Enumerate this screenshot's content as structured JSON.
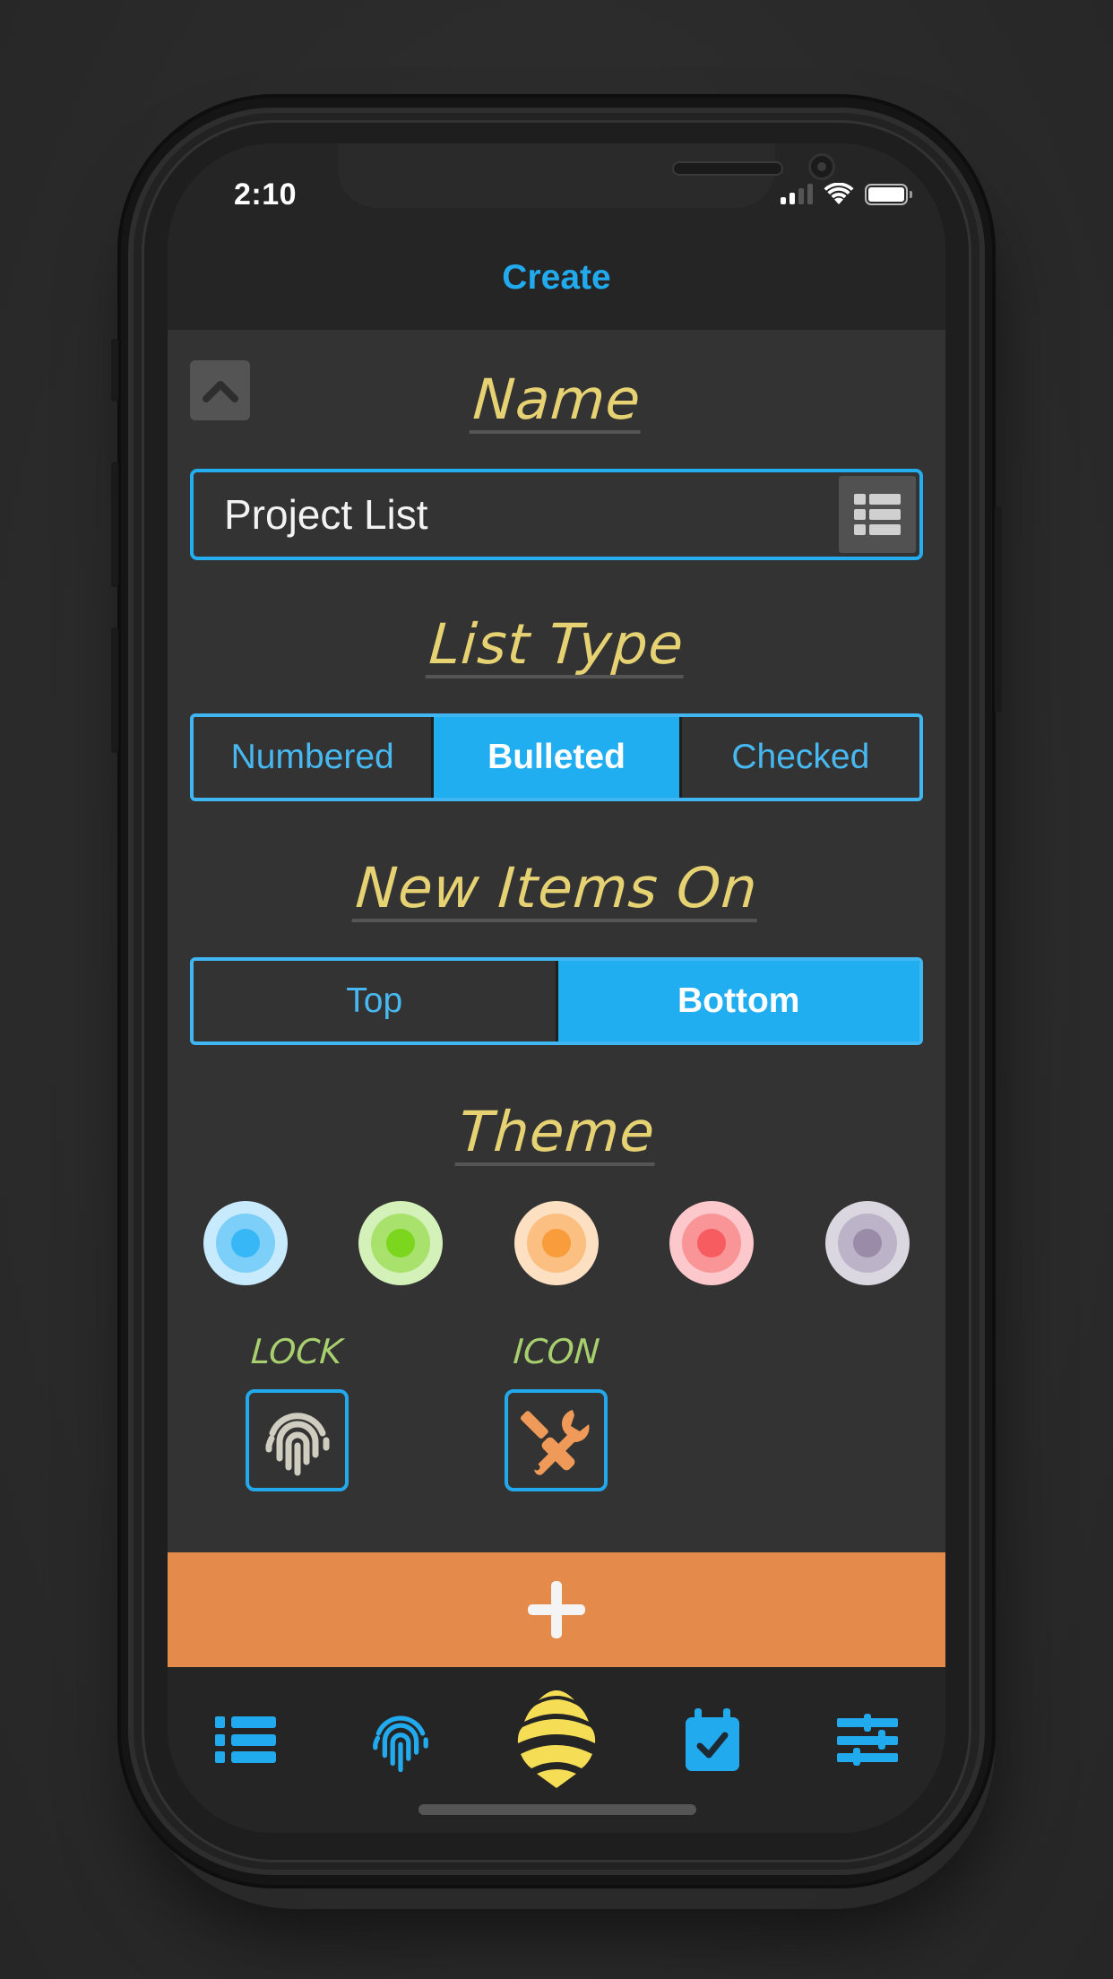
{
  "status_bar": {
    "time": "2:10",
    "signal_bars_filled": 2,
    "signal_bars_total": 4,
    "wifi_icon": "wifi-icon",
    "battery_icon": "battery-full-icon"
  },
  "header": {
    "title": "Create"
  },
  "collapse_button": {
    "icon": "chevron-up-icon"
  },
  "name_section": {
    "title": "Name",
    "input_value": "Project List",
    "list_picker_icon": "list-grid-icon"
  },
  "list_type_section": {
    "title": "List Type",
    "options": [
      "Numbered",
      "Bulleted",
      "Checked"
    ],
    "selected": "Bulleted"
  },
  "new_items_section": {
    "title": "New Items On",
    "options": [
      "Top",
      "Bottom"
    ],
    "selected": "Bottom"
  },
  "theme_section": {
    "title": "Theme",
    "themes": [
      {
        "name": "blue",
        "outer": "#c8eafd",
        "mid": "#7ccff8",
        "core": "#37b7f5"
      },
      {
        "name": "green",
        "outer": "#d3f1b8",
        "mid": "#a8e26c",
        "core": "#7cd61e"
      },
      {
        "name": "orange",
        "outer": "#fde0c2",
        "mid": "#fbbf82",
        "core": "#f89c3c"
      },
      {
        "name": "red",
        "outer": "#fdc8cb",
        "mid": "#fa9597",
        "core": "#f65c60"
      },
      {
        "name": "purple",
        "outer": "#dad7e1",
        "mid": "#bcb3c9",
        "core": "#9a8ca8"
      }
    ]
  },
  "options": {
    "lock_label": "LOCK",
    "lock_icon": "fingerprint-icon",
    "icon_label": "ICON",
    "icon_icon": "tools-icon"
  },
  "add_button": {
    "icon": "plus-icon"
  },
  "tab_bar": {
    "items": [
      {
        "name": "lists",
        "icon": "list-icon"
      },
      {
        "name": "lock",
        "icon": "fingerprint-icon"
      },
      {
        "name": "home",
        "icon": "bee-logo-icon"
      },
      {
        "name": "calendar",
        "icon": "calendar-check-icon"
      },
      {
        "name": "settings",
        "icon": "sliders-icon"
      }
    ]
  },
  "colors": {
    "accent": "#20aef0",
    "title_yellow": "#e6d272",
    "label_green": "#a7cf6e",
    "add_orange": "#e48b4c",
    "bee_yellow": "#f5dd55"
  }
}
